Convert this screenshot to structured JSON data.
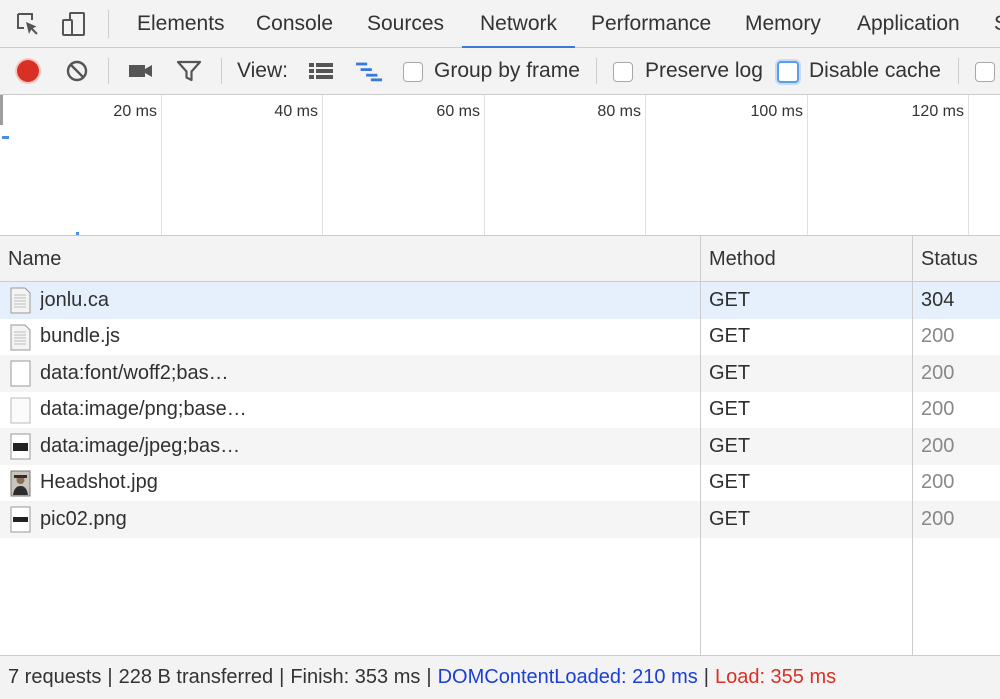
{
  "tabs": [
    "Elements",
    "Console",
    "Sources",
    "Network",
    "Performance",
    "Memory",
    "Application",
    "S"
  ],
  "active_tab": "Network",
  "toolbar": {
    "view_label": "View:",
    "group_by_frame": "Group by frame",
    "preserve_log": "Preserve log",
    "disable_cache": "Disable cache"
  },
  "overview": {
    "ticks": [
      "20 ms",
      "40 ms",
      "60 ms",
      "80 ms",
      "100 ms",
      "120 ms"
    ]
  },
  "table": {
    "headers": {
      "name": "Name",
      "method": "Method",
      "status": "Status"
    },
    "rows": [
      {
        "name": "jonlu.ca",
        "method": "GET",
        "status": "304",
        "icon": "document-icon"
      },
      {
        "name": "bundle.js",
        "method": "GET",
        "status": "200",
        "icon": "script-file-icon"
      },
      {
        "name": "data:font/woff2;bas…",
        "method": "GET",
        "status": "200",
        "icon": "blank-file-icon"
      },
      {
        "name": "data:image/png;base…",
        "method": "GET",
        "status": "200",
        "icon": "blank-image-icon"
      },
      {
        "name": "data:image/jpeg;bas…",
        "method": "GET",
        "status": "200",
        "icon": "dark-image-icon"
      },
      {
        "name": "Headshot.jpg",
        "method": "GET",
        "status": "200",
        "icon": "photo-thumbnail-icon"
      },
      {
        "name": "pic02.png",
        "method": "GET",
        "status": "200",
        "icon": "dark-image-icon"
      }
    ]
  },
  "statusbar": {
    "requests": "7 requests",
    "transferred": "228 B transferred",
    "finish": "Finish: 353 ms",
    "dom_content_loaded": "DOMContentLoaded: 210 ms",
    "load": "Load: 355 ms",
    "separator": "|"
  },
  "colors": {
    "accent": "#3879d9",
    "record": "#d93025",
    "dom_content_loaded": "#1a3fd6",
    "load": "#d93025",
    "selected_row": "#e6f0fd"
  }
}
